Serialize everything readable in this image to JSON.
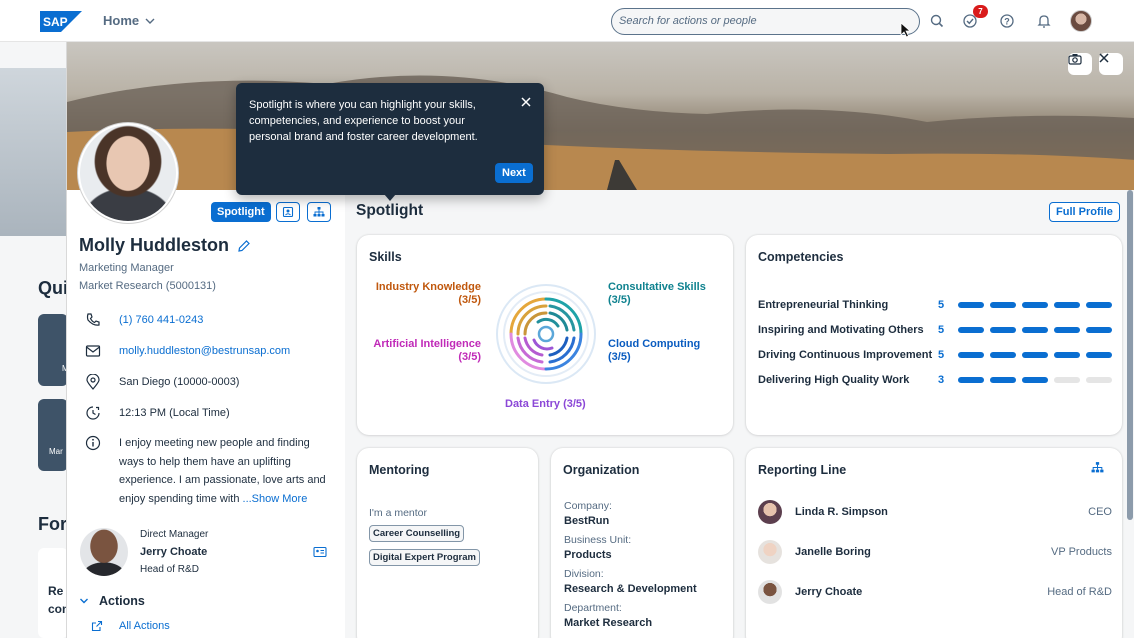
{
  "shell": {
    "logo_text": "SAP",
    "home_label": "Home",
    "search_placeholder": "Search for actions or people",
    "notification_count": "7",
    "icons": [
      "search-icon",
      "task-icon",
      "help-icon",
      "bell-icon",
      "user-avatar"
    ]
  },
  "background": {
    "quick_title": "Qui",
    "tile1_label": "M",
    "tile2_label": "Mar",
    "for_title": "For",
    "card_text1": "Re",
    "card_text2": "con"
  },
  "profile": {
    "name": "Molly Huddleston",
    "title": "Marketing Manager",
    "department": "Market Research (5000131)",
    "phone": "(1) 760 441-0243",
    "email": "molly.huddleston@bestrunsap.com",
    "location": "San Diego (10000-0003)",
    "local_time": "12:13 PM (Local Time)",
    "bio": "I enjoy meeting new people and finding ways to help them have an uplifting experience. I am passionate, love arts and enjoy spending time with ",
    "show_more": "...Show More",
    "spotlight_pill": "Spotlight"
  },
  "manager": {
    "label": "Direct Manager",
    "name": "Jerry Choate",
    "role": "Head of R&D"
  },
  "actions": {
    "title": "Actions",
    "all_actions": "All Actions"
  },
  "spotlight": {
    "title": "Spotlight",
    "full_profile": "Full Profile"
  },
  "popover": {
    "text": "Spotlight is where you can highlight your skills, competencies, and experience to boost your personal brand and foster career development.",
    "next": "Next"
  },
  "skills": {
    "title": "Skills",
    "items": [
      {
        "name": "Industry Knowledge",
        "level": "(3/5)",
        "color": "#c0580e"
      },
      {
        "name": "Consultative Skills",
        "level": "(3/5)",
        "color": "#0f828f"
      },
      {
        "name": "Artificial Intelligence",
        "level": "(3/5)",
        "color": "#c02ab8"
      },
      {
        "name": "Cloud Computing",
        "level": "(3/5)",
        "color": "#0a5cc0"
      },
      {
        "name": "Data Entry (3/5)",
        "level": "",
        "color": "#8b47d7"
      }
    ]
  },
  "competencies": {
    "title": "Competencies",
    "items": [
      {
        "name": "Entrepreneurial Thinking",
        "value": "5",
        "level": 5
      },
      {
        "name": "Inspiring and Motivating Others",
        "value": "5",
        "level": 5
      },
      {
        "name": "Driving Continuous Improvement",
        "value": "5",
        "level": 5
      },
      {
        "name": "Delivering High Quality Work",
        "value": "3",
        "level": 3
      }
    ]
  },
  "mentoring": {
    "title": "Mentoring",
    "subtitle": "I'm a mentor",
    "tags": [
      "Career Counselling",
      "Digital Expert Program"
    ]
  },
  "organization": {
    "title": "Organization",
    "company_label": "Company:",
    "company": "BestRun",
    "bu_label": "Business Unit:",
    "bu": "Products",
    "division_label": "Division:",
    "division": "Research & Development",
    "dept_label": "Department:",
    "dept": "Market Research"
  },
  "reporting": {
    "title": "Reporting Line",
    "people": [
      {
        "name": "Linda R. Simpson",
        "role": "CEO"
      },
      {
        "name": "Janelle Boring",
        "role": "VP Products"
      },
      {
        "name": "Jerry Choate",
        "role": "Head of R&D"
      }
    ]
  },
  "colors": {
    "accent": "#0a6ed1",
    "text": "#1d2d3e",
    "popover_bg": "#1d2d3e"
  }
}
